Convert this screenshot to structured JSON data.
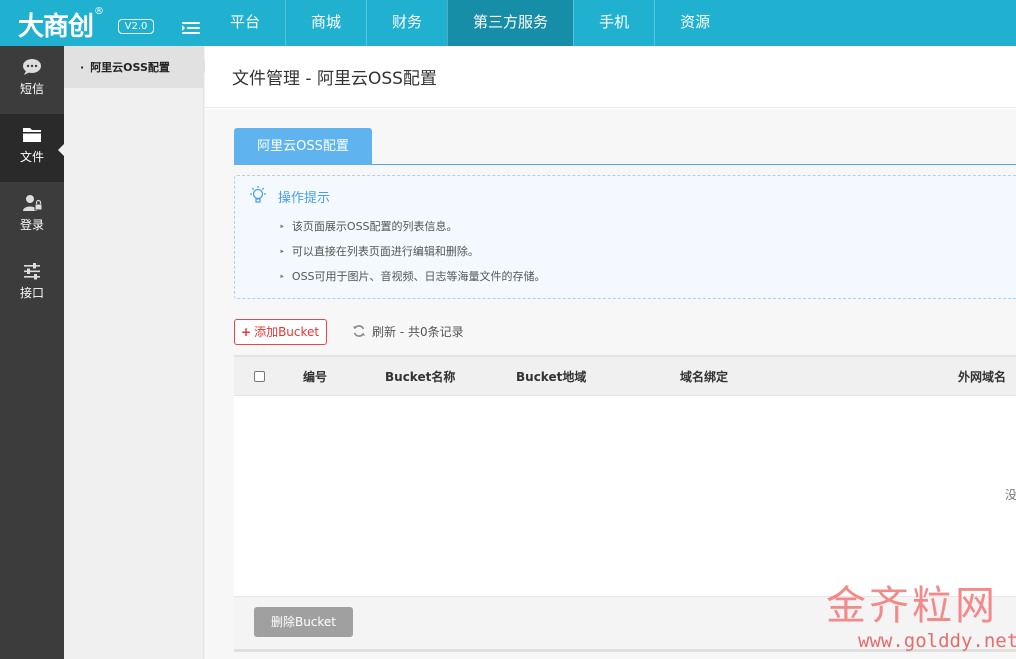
{
  "app": {
    "logo": "大商创",
    "logo_mark": "®",
    "version": "V2.0"
  },
  "topnav": {
    "items": [
      {
        "label": "平台",
        "active": false
      },
      {
        "label": "商城",
        "active": false
      },
      {
        "label": "财务",
        "active": false
      },
      {
        "label": "第三方服务",
        "active": true
      },
      {
        "label": "手机",
        "active": false
      },
      {
        "label": "资源",
        "active": false
      }
    ]
  },
  "sidebar": {
    "items": [
      {
        "label": "短信",
        "icon": "chat-icon",
        "active": false
      },
      {
        "label": "文件",
        "icon": "folder-icon",
        "active": true
      },
      {
        "label": "登录",
        "icon": "user-lock-icon",
        "active": false
      },
      {
        "label": "接口",
        "icon": "sliders-icon",
        "active": false
      }
    ]
  },
  "subsidebar": {
    "items": [
      {
        "label": "阿里云OSS配置",
        "active": true
      }
    ]
  },
  "page": {
    "title": "文件管理 - 阿里云OSS配置",
    "tab": "阿里云OSS配置"
  },
  "tips": {
    "title": "操作提示",
    "items": [
      "该页面展示OSS配置的列表信息。",
      "可以直接在列表页面进行编辑和删除。",
      "OSS可用于图片、音视频、日志等海量文件的存储。"
    ]
  },
  "toolbar": {
    "add_label": "添加Bucket",
    "add_icon": "+",
    "refresh_label": "刷新 - 共0条记录"
  },
  "table": {
    "columns": [
      "编号",
      "Bucket名称",
      "Bucket地域",
      "域名绑定",
      "外网域名"
    ],
    "rows": [],
    "empty_text": "没"
  },
  "footer": {
    "delete_label": "删除Bucket"
  },
  "watermark": {
    "main": "金齐粒网",
    "url": "www.golddy.net"
  },
  "colors": {
    "topbar": "#21b1d0",
    "nav_active": "#178ea8",
    "sidebar": "#3c3c3c",
    "tab": "#5fb4f0",
    "danger": "#e33333"
  }
}
